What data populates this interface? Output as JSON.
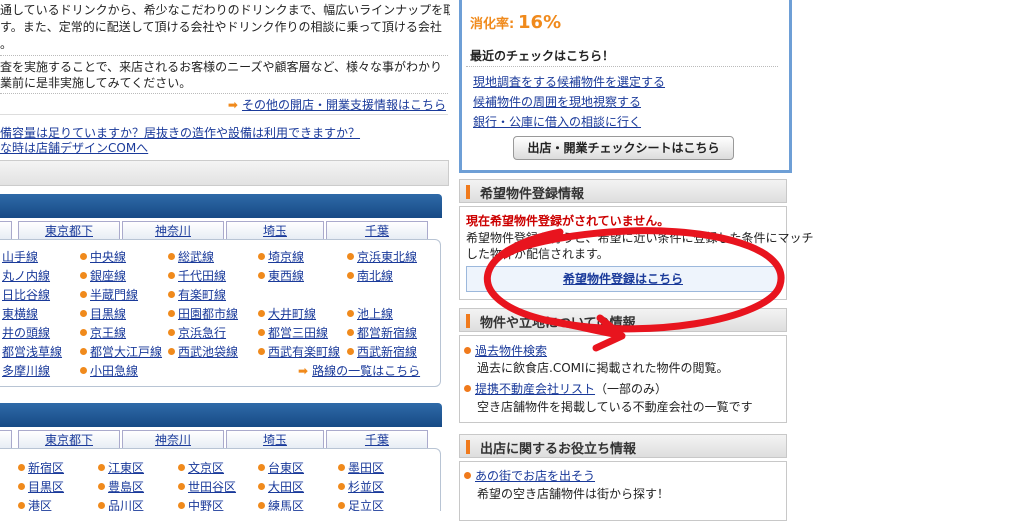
{
  "left": {
    "intro_lines": [
      "通しているドリンクから、希少なこだわりのドリンクまで、幅広いラインナップを取り揃",
      "す。また、定常的に配送して頂ける会社やドリンク作りの相談に乗って頂ける会社",
      "。"
    ],
    "survey_lines": [
      "査を実施することで、来店されるお客様のニーズや顧客層など、様々な事がわかり",
      "業前に是非実施してみてください。"
    ],
    "more_link": "その他の開店・開業支援情報はこちら",
    "question_link_1": "備容量は足りていますか？居抜きの造作や設備は利用できますか？",
    "question_link_2": "な時は店舗デザインCOMへ",
    "tabs": [
      "東京都下",
      "神奈川",
      "埼玉",
      "千葉"
    ],
    "lines": [
      [
        "山手線",
        "中央線",
        "総武線",
        "埼京線",
        "京浜東北線"
      ],
      [
        "丸ノ内線",
        "銀座線",
        "千代田線",
        "東西線",
        "南北線"
      ],
      [
        "日比谷線",
        "半蔵門線",
        "有楽町線",
        "",
        ""
      ],
      [
        "東横線",
        "目黒線",
        "田園都市線",
        "大井町線",
        "池上線"
      ],
      [
        "井の頭線",
        "京王線",
        "京浜急行",
        "都営三田線",
        "都営新宿線"
      ],
      [
        "都営浅草線",
        "都営大江戸線",
        "西武池袋線",
        "西武有楽町線",
        "西武新宿線"
      ],
      [
        "多摩川線",
        "小田急線",
        "",
        "",
        ""
      ]
    ],
    "lines_more": "路線の一覧はこちら",
    "tabs2": [
      "東京都下",
      "神奈川",
      "埼玉",
      "千葉"
    ],
    "wards": [
      [
        "新宿区",
        "江東区",
        "文京区",
        "台東区",
        "墨田区"
      ],
      [
        "目黒区",
        "豊島区",
        "世田谷区",
        "大田区",
        "杉並区"
      ],
      [
        "港区",
        "品川区",
        "中野区",
        "練馬区",
        "足立区"
      ]
    ]
  },
  "right": {
    "digest_label": "消化率:",
    "digest_value": "16%",
    "recent_check_title": "最近のチェックはこちら！",
    "check_links": [
      "現地調査をする候補物件を選定する",
      "候補物件の周囲を現地視察する",
      "銀行・公庫に借入の相談に行く"
    ],
    "checksheet_button": "出店・開業チェックシートはこちら",
    "wish": {
      "title": "希望物件登録情報",
      "warning": "現在希望物件登録がされていません。",
      "desc_line1": "希望物件登録を行うと、希望に近い条件に登録した条件にマッチ",
      "desc_line2": "した物件が配信されます。",
      "register_link": "希望物件登録はこちら"
    },
    "property_info": {
      "title": "物件や立地についての情報",
      "items": [
        {
          "link": "過去物件検索",
          "suffix": "",
          "desc": "過去に飲食店.COMIに掲載された物件の閲覧。"
        },
        {
          "link": "提携不動産会社リスト",
          "suffix": "（一部のみ）",
          "desc": "空き店舗物件を掲載している不動産会社の一覧です"
        }
      ]
    },
    "useful_info": {
      "title": "出店に関するお役立ち情報",
      "items": [
        {
          "link": "あの街でお店を出そう",
          "desc": "希望の空き店舗物件は街から探す！"
        }
      ]
    }
  },
  "colors": {
    "accent_orange": "#f08a1c",
    "link_blue": "#1a3a9a",
    "header_blue": "#1d5591",
    "frame_blue": "#6e9fd6",
    "annotation_red": "#e8141e",
    "warning_red": "#cc0000"
  }
}
